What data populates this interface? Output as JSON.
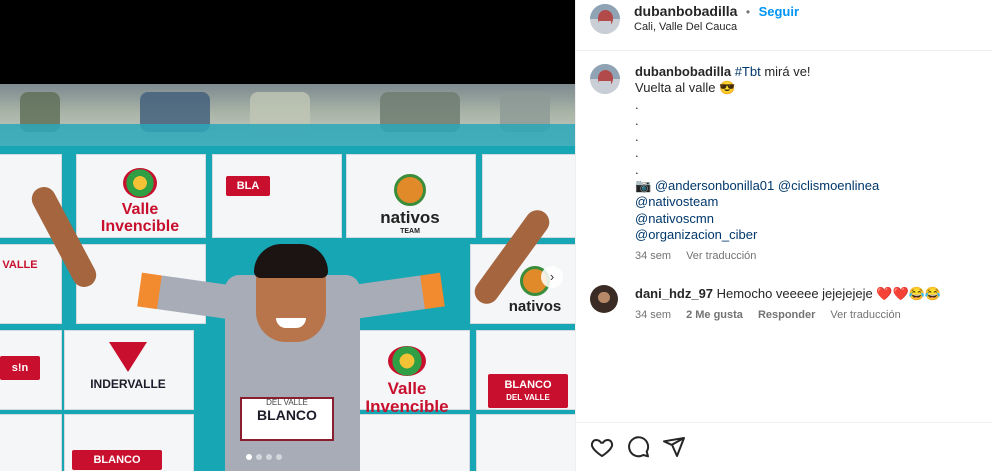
{
  "colors": {
    "link": "#00376b",
    "follow": "#0095f6",
    "muted": "#737373",
    "heart": "#ed4956"
  },
  "post": {
    "username": "dubanbobadilla",
    "follow_label": "Seguir",
    "separator": "•",
    "location": "Cali, Valle Del Cauca"
  },
  "photo": {
    "logos": {
      "valle_1": "Valle",
      "valle_2": "Invencible",
      "nativos": "nativos",
      "nativos_team": "TEAM",
      "blanco_1": "BLANCO",
      "blanco_2": "DEL VALLE",
      "indervalle": "INDERVALLE",
      "sponsor_top": "BLANCO",
      "sponsor_sub": "DEL VALLE"
    },
    "next_icon": "chevron-right-icon",
    "slides": 4,
    "current_slide": 1
  },
  "caption": {
    "username": "dubanbobadilla",
    "hashtag": "#Tbt",
    "text_1": " mirá ve!",
    "line_2": "Vuelta al valle 😎",
    "dot": ".",
    "camera": "📷",
    "mention_1": "@andersonbonilla01",
    "mention_2": "@ciclismoenlinea",
    "mention_3": "@nativosteam",
    "mention_4": "@nativoscmn",
    "mention_5": "@organizacion_ciber",
    "time": "34 sem",
    "translate": "Ver traducción"
  },
  "comment": {
    "username": "dani_hdz_97",
    "text": "Hemocho veeeee jejejejeje ❤️❤️😂😂",
    "time": "34 sem",
    "likes": "2 Me gusta",
    "reply": "Responder",
    "translate": "Ver traducción"
  },
  "actions": {
    "like_icon": "heart-icon",
    "comment_icon": "comment-icon",
    "share_icon": "share-icon"
  }
}
